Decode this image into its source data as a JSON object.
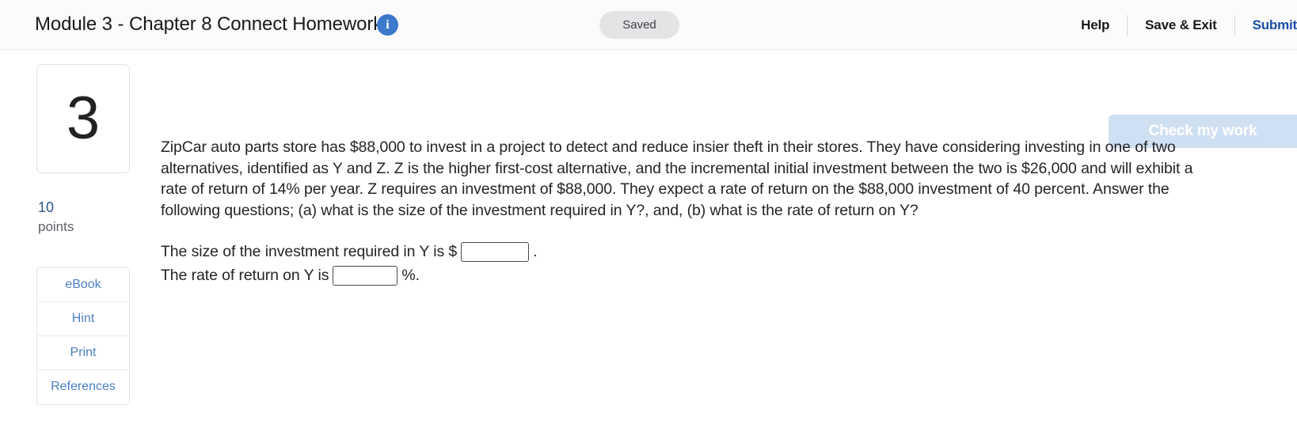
{
  "header": {
    "title": "Module 3 - Chapter 8 Connect Homework",
    "info_icon": "info-icon",
    "status_badge": "Saved",
    "actions": {
      "help": "Help",
      "save_exit": "Save & Exit",
      "submit": "Submit"
    }
  },
  "sidebar": {
    "question_number": "3",
    "points_value": "10",
    "points_label": "points",
    "buttons": [
      {
        "label": "eBook",
        "name": "ebook"
      },
      {
        "label": "Hint",
        "name": "hint"
      },
      {
        "label": "Print",
        "name": "print"
      },
      {
        "label": "References",
        "name": "references"
      }
    ]
  },
  "main": {
    "check_my_work": "Check my work",
    "question_text": "ZipCar auto parts store has $88,000 to invest in a project to detect and reduce insier theft in their stores. They have considering investing in one of two alternatives, identified as Y and Z. Z is the higher first-cost alternative, and the incremental initial investment between the two is $26,000 and will exhibit a rate of return of 14% per year. Z requires an investment of $88,000. They expect a rate of return on the $88,000 investment of 40 percent. Answer the following questions; (a) what is the size of the investment required in Y?, and, (b) what is the rate of return on Y?",
    "answer_lines": {
      "line1_prefix": "The size of the investment required in Y is $",
      "line1_value": "",
      "line1_placeholder": "",
      "line1_suffix": ".",
      "line2_prefix": "The rate of return on Y is",
      "line2_value": "",
      "line2_placeholder": "",
      "line2_suffix": "%."
    }
  },
  "colors": {
    "link_blue": "#4a80c4",
    "submit_blue": "#1b4ea8",
    "check_button_bg": "#cfe0f2",
    "info_icon_bg": "#3b79cc",
    "badge_bg": "#e4e4e6"
  }
}
